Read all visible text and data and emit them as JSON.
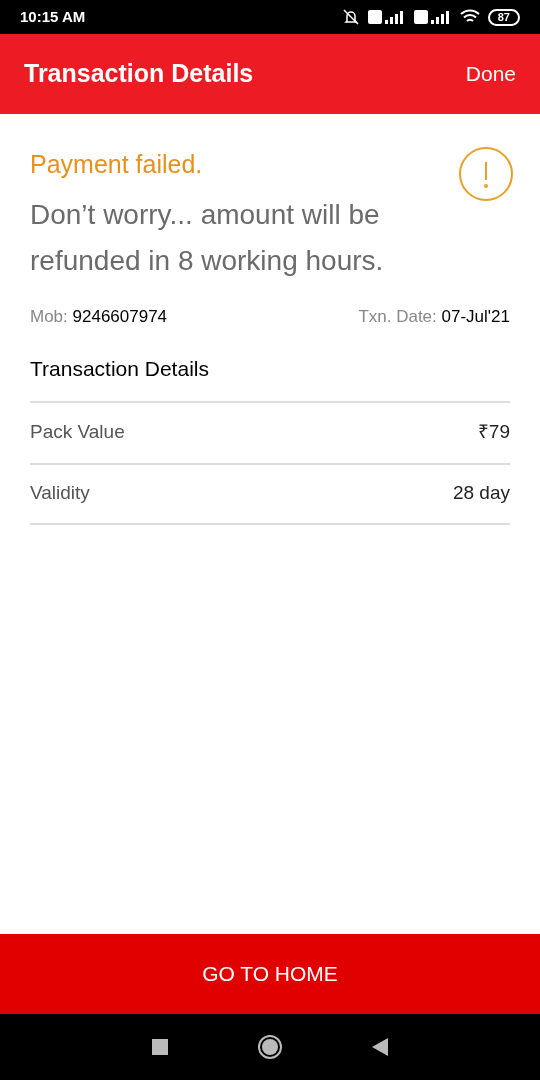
{
  "status_bar": {
    "time": "10:15 AM",
    "battery": "87"
  },
  "header": {
    "title": "Transaction Details",
    "action": "Done"
  },
  "status": {
    "title": "Payment failed.",
    "message": "Don’t worry... amount will be refunded in 8 working hours."
  },
  "meta": {
    "mob_label": "Mob:",
    "mob_value": "9246607974",
    "date_label": "Txn. Date:",
    "date_value": "07-Jul'21"
  },
  "details": {
    "title": "Transaction Details",
    "rows": [
      {
        "label": "Pack Value",
        "value": "₹79"
      },
      {
        "label": "Validity",
        "value": "28 day"
      }
    ]
  },
  "footer_button": "GO TO HOME"
}
